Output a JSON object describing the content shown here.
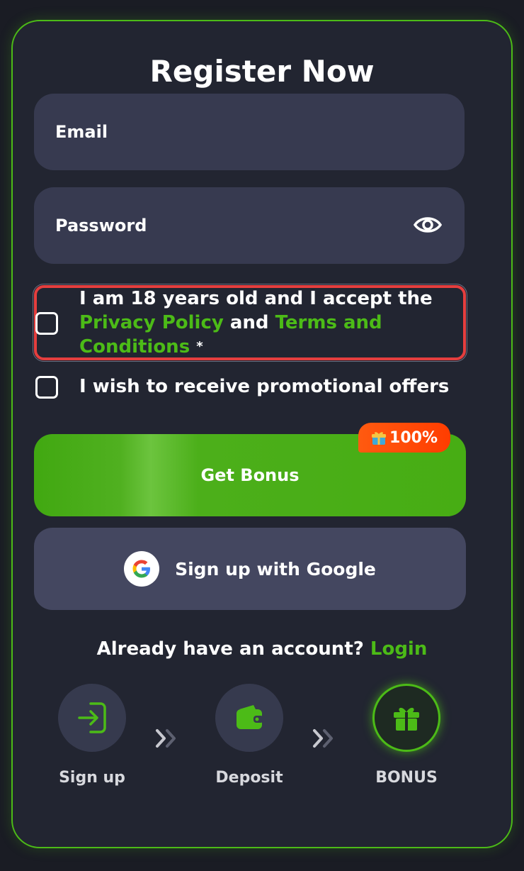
{
  "title": "Register Now",
  "email_placeholder": "Email",
  "password_placeholder": "Password",
  "terms": {
    "prefix": "I am 18 years old and I accept the",
    "privacy_link": "Privacy Policy",
    "and": "and",
    "terms_link": "Terms and Conditions",
    "required_mark": "*"
  },
  "promo_label": "I wish to receive promotional offers",
  "bonus_button": {
    "label": "Get Bonus",
    "badge": "100%"
  },
  "google_button": {
    "label": "Sign up with Google",
    "g": "G"
  },
  "login_line": {
    "text": "Already have an account?",
    "link": "Login"
  },
  "steps": [
    {
      "label": "Sign up",
      "icon": "sign-in-icon"
    },
    {
      "label": "Deposit",
      "icon": "wallet-icon"
    },
    {
      "label": "BONUS",
      "icon": "gift-icon"
    }
  ],
  "colors": {
    "accent": "#4cbb17",
    "error": "#e53e3e",
    "badge": "#ff4a08",
    "background": "#222531"
  }
}
